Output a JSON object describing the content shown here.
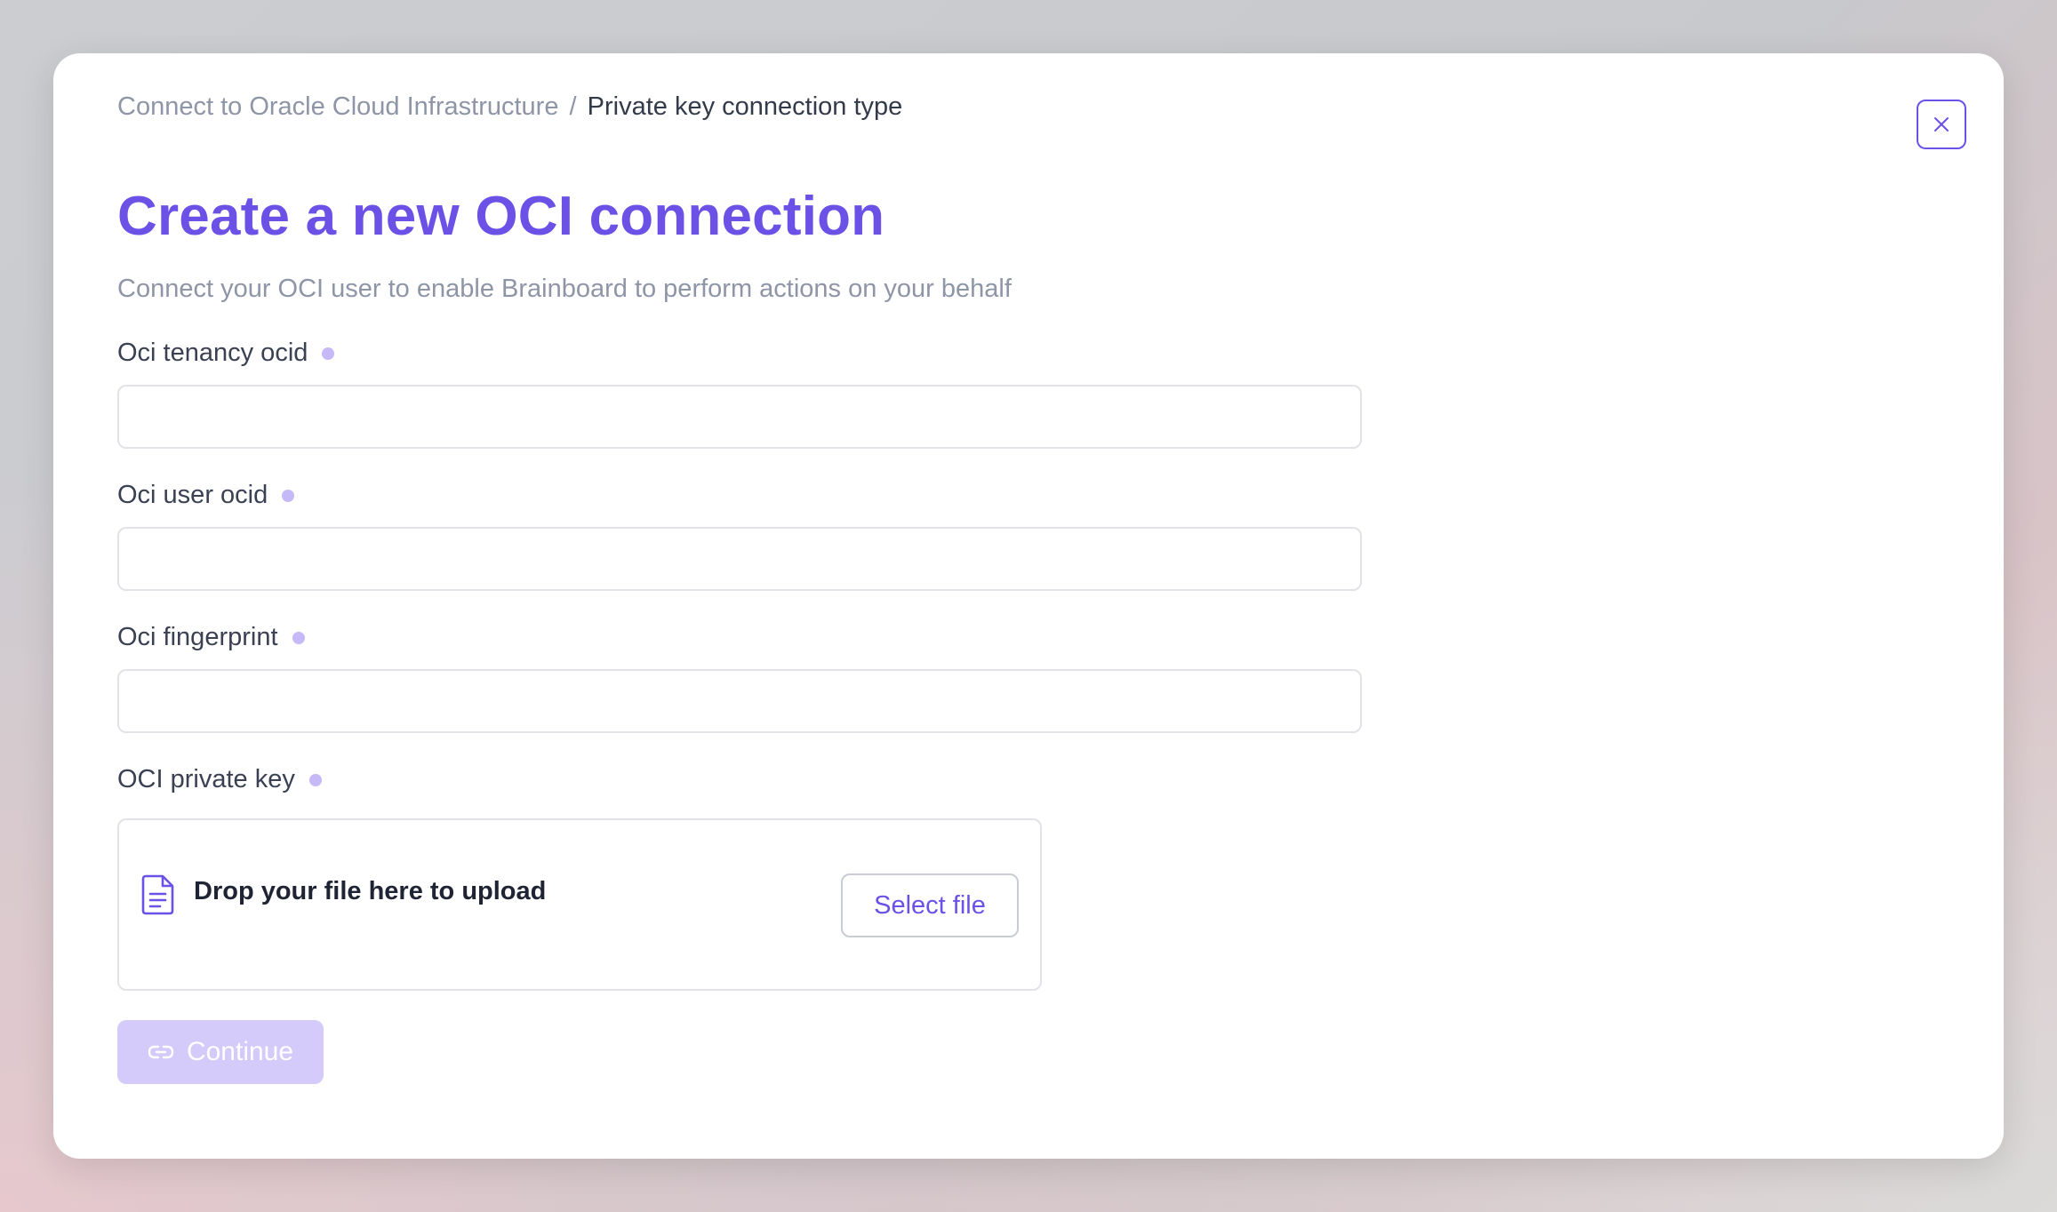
{
  "breadcrumb": {
    "parent": "Connect to Oracle Cloud Infrastructure",
    "separator": "/",
    "current": "Private key connection type"
  },
  "close_icon": "close-icon",
  "header": {
    "title": "Create a new OCI connection",
    "subtitle": "Connect your OCI user to enable Brainboard to perform actions on your behalf"
  },
  "form": {
    "tenancy": {
      "label": "Oci tenancy ocid",
      "value": "",
      "placeholder": ""
    },
    "user": {
      "label": "Oci user ocid",
      "value": "",
      "placeholder": ""
    },
    "fingerprint": {
      "label": "Oci fingerprint",
      "value": "",
      "placeholder": ""
    },
    "private_key": {
      "label": "OCI private key",
      "drop_text": "Drop your file here to upload",
      "select_label": "Select file",
      "icon": "file-text-icon"
    },
    "continue_label": "Continue",
    "continue_icon": "link-icon",
    "continue_disabled": true
  },
  "colors": {
    "accent": "#6c51e6",
    "required_dot": "#c6b9f7",
    "disabled_button": "#d4cbfa",
    "muted_text": "#8e95a6"
  }
}
